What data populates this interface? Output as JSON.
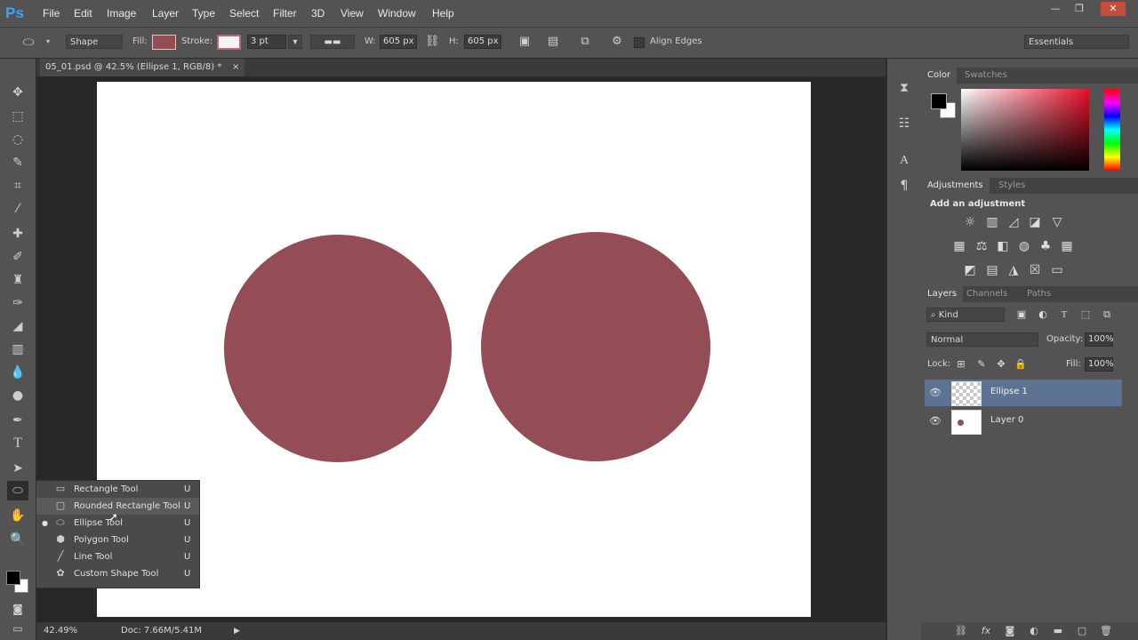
{
  "app": {
    "logo": "Ps"
  },
  "menu": [
    "File",
    "Edit",
    "Image",
    "Layer",
    "Type",
    "Select",
    "Filter",
    "3D",
    "View",
    "Window",
    "Help"
  ],
  "window_controls": {
    "minimize": "—",
    "restore": "❐",
    "close": "✕"
  },
  "options_bar": {
    "mode": "Shape",
    "fill_label": "Fill:",
    "fill_color": "#944c55",
    "stroke_label": "Stroke:",
    "stroke_width": "3 pt",
    "width_label": "W:",
    "width_value": "605 px",
    "height_label": "H:",
    "height_value": "605 px",
    "align_edges": "Align Edges",
    "workspace": "Essentials"
  },
  "document": {
    "tab_title": "05_01.psd @ 42.5% (Ellipse 1, RGB/8) *",
    "close": "×",
    "shape_color": "#944c55"
  },
  "status": {
    "zoom": "42.49%",
    "doc_size": "Doc: 7.66M/5.41M"
  },
  "shape_flyout": {
    "items": [
      {
        "label": "Rectangle Tool",
        "key": "U",
        "icon": "rectangle-icon"
      },
      {
        "label": "Rounded Rectangle Tool",
        "key": "U",
        "icon": "rounded-rectangle-icon"
      },
      {
        "label": "Ellipse Tool",
        "key": "U",
        "icon": "ellipse-icon"
      },
      {
        "label": "Polygon Tool",
        "key": "U",
        "icon": "polygon-icon"
      },
      {
        "label": "Line Tool",
        "key": "U",
        "icon": "line-icon"
      },
      {
        "label": "Custom Shape Tool",
        "key": "U",
        "icon": "custom-shape-icon"
      }
    ]
  },
  "color_panel": {
    "tabs": [
      "Color",
      "Swatches"
    ],
    "foreground": "#000000",
    "background": "#ffffff"
  },
  "adjustments_panel": {
    "tabs": [
      "Adjustments",
      "Styles"
    ],
    "heading": "Add an adjustment"
  },
  "layers_panel": {
    "tabs": [
      "Layers",
      "Channels",
      "Paths"
    ],
    "filter": "Kind",
    "blend_mode": "Normal",
    "opacity_label": "Opacity:",
    "opacity_value": "100%",
    "lock_label": "Lock:",
    "fill_label": "Fill:",
    "fill_value": "100%",
    "layers": [
      {
        "name": "Ellipse 1",
        "selected": true
      },
      {
        "name": "Layer 0",
        "selected": false
      }
    ]
  }
}
